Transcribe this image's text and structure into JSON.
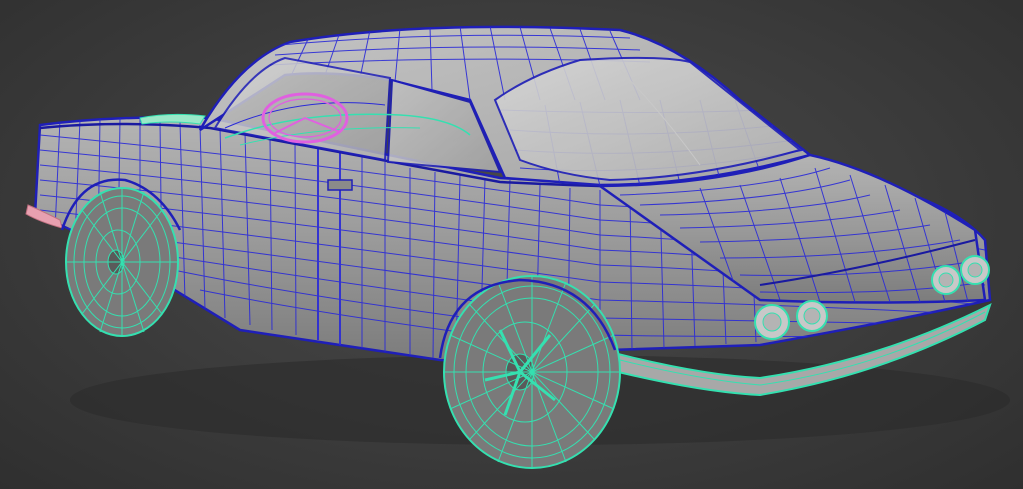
{
  "viewport": {
    "background_color": "#3c3c3c",
    "shaded_color": "#9a9a9a",
    "body_wire_color": "#2a2ad8",
    "wheel_wire_color": "#35e0b0",
    "steering_wheel_color": "#e060e0",
    "tail_light_color": "#e8a0b0"
  }
}
